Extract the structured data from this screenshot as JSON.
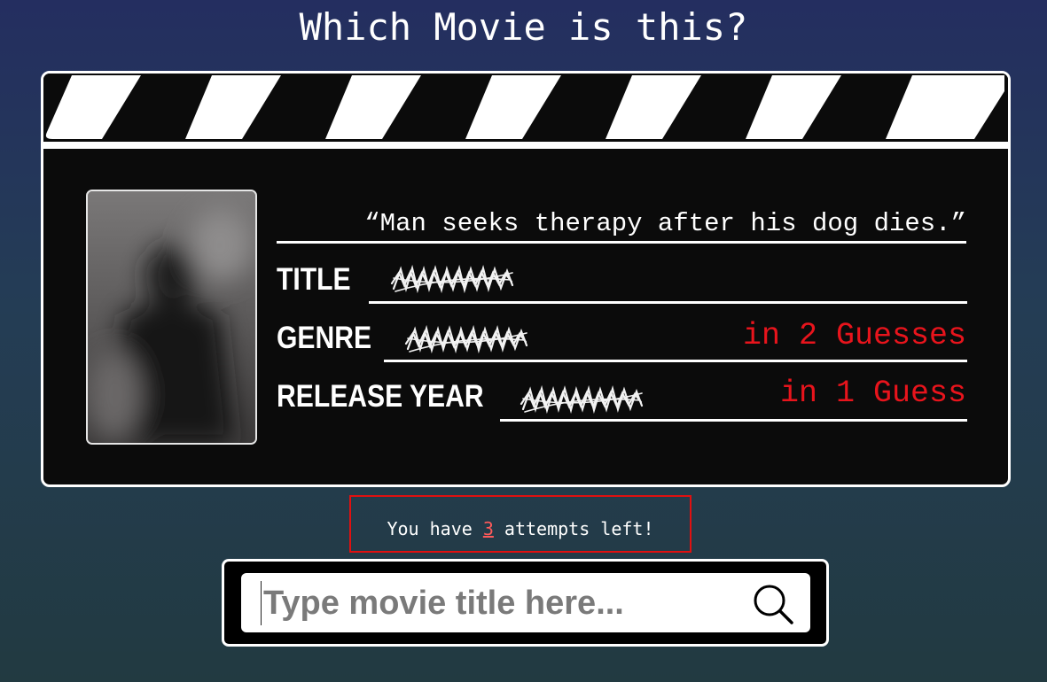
{
  "page": {
    "title": "Which Movie is this?"
  },
  "clue": {
    "quote": "“Man seeks therapy after his dog dies.”",
    "fields": [
      {
        "label": "TITLE",
        "hint": ""
      },
      {
        "label": "GENRE",
        "hint": "in 2 Guesses"
      },
      {
        "label": "RELEASE YEAR",
        "hint": "in 1 Guess"
      }
    ]
  },
  "attempts": {
    "prefix": "You have ",
    "count": "3",
    "suffix": " attempts left!"
  },
  "search": {
    "placeholder": "Type movie title here...",
    "value": ""
  },
  "colors": {
    "background_top": "#242e60",
    "background_bottom": "#223a41",
    "hint_red": "#e8141c",
    "attempts_border": "#e01010"
  },
  "icons": {
    "search": "search-icon",
    "scribble": "scribble-icon"
  }
}
